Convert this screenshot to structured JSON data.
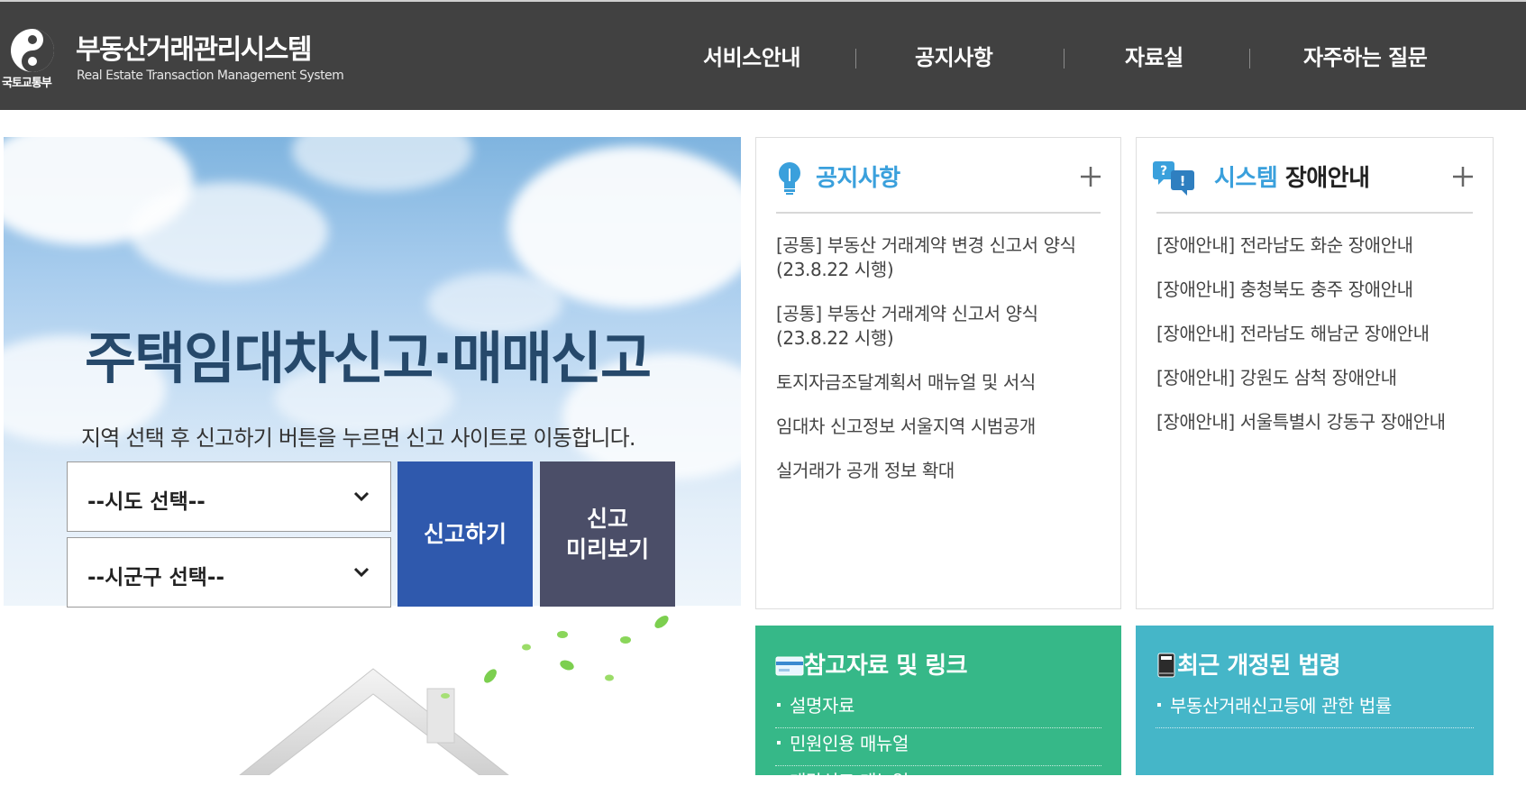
{
  "header": {
    "ministry": "국토교통부",
    "title": "부동산거래관리시스템",
    "subtitle": "Real Estate Transaction Management System",
    "nav": [
      "서비스안내",
      "공지사항",
      "자료실",
      "자주하는 질문"
    ]
  },
  "hero": {
    "title": "주택임대차신고·매매신고",
    "description": "지역 선택 후 신고하기 버튼을 누르면 신고 사이트로 이동합니다.",
    "sido_select": "--시도 선택--",
    "sigungu_select": "--시군구 선택--",
    "report_button": "신고하기",
    "preview_button_line1": "신고",
    "preview_button_line2": "미리보기"
  },
  "notice": {
    "title": "공지사항",
    "items": [
      "[공통] 부동산 거래계약 변경 신고서 양식 (23.8.22 시행)",
      "[공통] 부동산 거래계약 신고서 양식 (23.8.22 시행)",
      "토지자금조달계획서 매뉴얼 및 서식",
      "임대차 신고정보 서울지역 시범공개",
      "실거래가 공개 정보 확대"
    ]
  },
  "outage": {
    "title_accent": "시스템",
    "title_rest": "장애안내",
    "items": [
      "[장애안내] 전라남도 화순 장애안내",
      "[장애안내] 충청북도 충주 장애안내",
      "[장애안내] 전라남도 해남군 장애안내",
      "[장애안내] 강원도 삼척 장애안내",
      "[장애안내] 서울특별시 강동구 장애안내"
    ]
  },
  "references": {
    "title": "참고자료 및 링크",
    "items": [
      "설명자료",
      "민원인용 매뉴얼",
      "대량신고 매뉴얼"
    ]
  },
  "laws": {
    "title": "최근 개정된 법령",
    "items": [
      "부동산거래신고등에 관한 법률"
    ]
  },
  "colors": {
    "header_bg": "#414141",
    "accent_blue": "#3aa0dc",
    "report_button": "#2f59ad",
    "preview_button": "#4b4e68",
    "references_bg": "#36b888",
    "laws_bg": "#45b6c8"
  },
  "icons": {
    "emblem": "taegeuk-emblem-icon",
    "notice": "lightbulb-icon",
    "outage": "question-exclamation-icon",
    "references": "card-icon",
    "laws": "book-icon",
    "more": "plus-icon",
    "select": "chevron-down-icon"
  }
}
